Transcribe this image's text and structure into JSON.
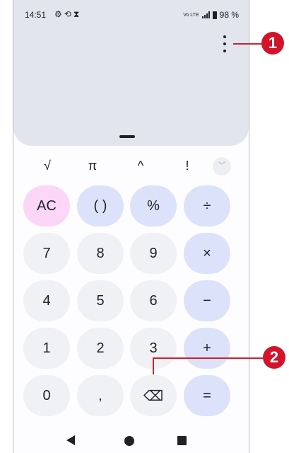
{
  "status_bar": {
    "time": "14:51",
    "icons": [
      "gear-icon",
      "sync-icon",
      "hourglass-icon"
    ],
    "network_label": "Vo LTE",
    "battery": "98 %"
  },
  "scientific_row": [
    "√",
    "π",
    "^",
    "!"
  ],
  "keypad": {
    "row1": [
      "AC",
      "( )",
      "%",
      "÷"
    ],
    "row2": [
      "7",
      "8",
      "9",
      "×"
    ],
    "row3": [
      "4",
      "5",
      "6",
      "−"
    ],
    "row4": [
      "1",
      "2",
      "3",
      "+"
    ],
    "row5": [
      "0",
      ",",
      "⌫",
      "="
    ]
  },
  "callouts": [
    "1",
    "2"
  ],
  "colors": {
    "display_bg": "#e3e5ee",
    "number_key": "#f0f1f5",
    "operator_key": "#dce2f9",
    "clear_key": "#fbd6f7",
    "callout": "#d3132a"
  }
}
